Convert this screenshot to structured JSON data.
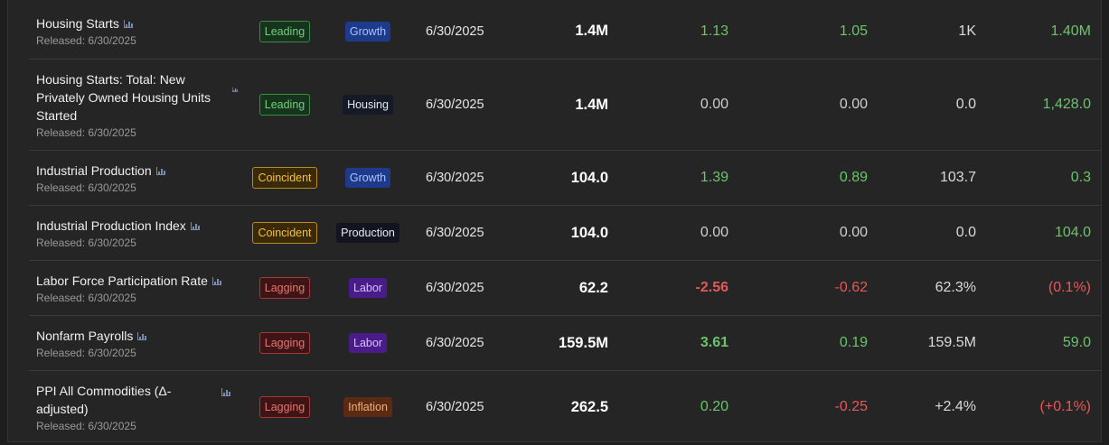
{
  "rows": [
    {
      "name": "Housing Starts",
      "released": "Released: 6/30/2025",
      "type": "Leading",
      "type_class": "leading",
      "category": "Growth",
      "cat_class": "cat-growth",
      "date": "6/30/2025",
      "value": "1.4M",
      "v1": "1.13",
      "v1_class": "green",
      "v2": "1.05",
      "v2_class": "green",
      "v3": "1K",
      "v4": "1.40M",
      "v4_class": "green"
    },
    {
      "name": "Housing Starts: Total: New Privately Owned Housing Units Started",
      "released": "Released: 6/30/2025",
      "type": "Leading",
      "type_class": "leading",
      "category": "Housing",
      "cat_class": "cat-housing",
      "date": "6/30/2025",
      "value": "1.4M",
      "v1": "0.00",
      "v1_class": "grey",
      "v2": "0.00",
      "v2_class": "grey",
      "v3": "0.0",
      "v4": "1,428.0",
      "v4_class": "green"
    },
    {
      "name": "Industrial Production",
      "released": "Released: 6/30/2025",
      "type": "Coincident",
      "type_class": "coincident",
      "category": "Growth",
      "cat_class": "cat-growth",
      "date": "6/30/2025",
      "value": "104.0",
      "v1": "1.39",
      "v1_class": "green",
      "v2": "0.89",
      "v2_class": "green",
      "v3": "103.7",
      "v4": "0.3",
      "v4_class": "green"
    },
    {
      "name": "Industrial Production Index",
      "released": "Released: 6/30/2025",
      "type": "Coincident",
      "type_class": "coincident",
      "category": "Production",
      "cat_class": "cat-production",
      "date": "6/30/2025",
      "value": "104.0",
      "v1": "0.00",
      "v1_class": "grey",
      "v2": "0.00",
      "v2_class": "grey",
      "v3": "0.0",
      "v4": "104.0",
      "v4_class": "green"
    },
    {
      "name": "Labor Force Participation Rate",
      "released": "Released: 6/30/2025",
      "type": "Lagging",
      "type_class": "lagging",
      "category": "Labor",
      "cat_class": "cat-labor",
      "date": "6/30/2025",
      "value": "62.2",
      "v1": "-2.56",
      "v1_class": "red bold",
      "v2": "-0.62",
      "v2_class": "red",
      "v3": "62.3%",
      "v4": "(0.1%)",
      "v4_class": "red"
    },
    {
      "name": "Nonfarm Payrolls",
      "released": "Released: 6/30/2025",
      "type": "Lagging",
      "type_class": "lagging",
      "category": "Labor",
      "cat_class": "cat-labor",
      "date": "6/30/2025",
      "value": "159.5M",
      "v1": "3.61",
      "v1_class": "green bold",
      "v2": "0.19",
      "v2_class": "green",
      "v3": "159.5M",
      "v4": "59.0",
      "v4_class": "green"
    },
    {
      "name": "PPI All Commodities (Δ-adjusted)",
      "released": "Released: 6/30/2025",
      "type": "Lagging",
      "type_class": "lagging",
      "category": "Inflation",
      "cat_class": "cat-inflation",
      "date": "6/30/2025",
      "value": "262.5",
      "v1": "0.20",
      "v1_class": "green",
      "v2": "-0.25",
      "v2_class": "red",
      "v3": "+2.4%",
      "v4": "(+0.1%)",
      "v4_class": "red"
    }
  ]
}
